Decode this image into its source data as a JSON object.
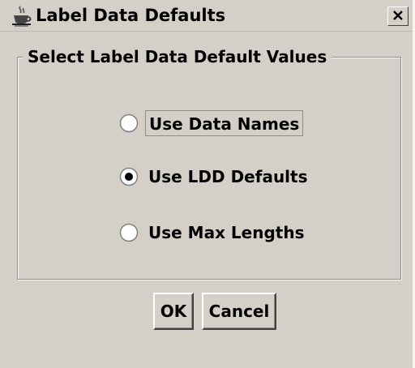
{
  "window": {
    "title": "Label Data Defaults",
    "app_icon": "java-coffee-cup-icon",
    "close_glyph": "X",
    "background_color": "#d4d0c8"
  },
  "group": {
    "title": "Select Label Data Default Values",
    "options": [
      {
        "label": "Use Data Names",
        "selected": false,
        "focused": true
      },
      {
        "label": "Use LDD Defaults",
        "selected": true,
        "focused": false
      },
      {
        "label": "Use Max Lengths",
        "selected": false,
        "focused": false
      }
    ]
  },
  "buttons": {
    "ok_label": "OK",
    "cancel_label": "Cancel"
  }
}
